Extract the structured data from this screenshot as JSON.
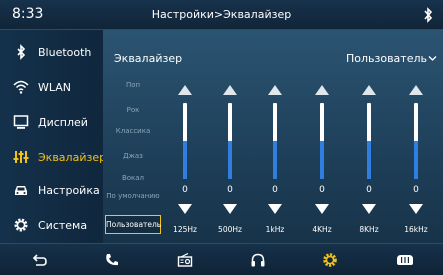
{
  "status": {
    "time": "8:33",
    "title": "Настройки>Эквалайзер",
    "bluetooth_icon": "bluetooth-icon"
  },
  "sidebar": {
    "items": [
      {
        "label": "Bluetooth",
        "icon": "bluetooth-icon",
        "active": false
      },
      {
        "label": "WLAN",
        "icon": "wifi-icon",
        "active": false
      },
      {
        "label": "Дисплей",
        "icon": "display-icon",
        "active": false
      },
      {
        "label": "Эквалайзер",
        "icon": "equalizer-icon",
        "active": true
      },
      {
        "label": "Настройка",
        "icon": "car-icon",
        "active": false
      },
      {
        "label": "Система",
        "icon": "gear-icon",
        "active": false
      }
    ]
  },
  "equalizer": {
    "title": "Эквалайзер",
    "preset_selected": "Пользователь",
    "presets": [
      "Поп",
      "Рок",
      "Классика",
      "Джаз",
      "Вокал",
      "По умолчанию",
      "Пользователь"
    ],
    "bands": [
      {
        "freq": "125Hz",
        "value": "0",
        "level": 0.5
      },
      {
        "freq": "500Hz",
        "value": "0",
        "level": 0.5
      },
      {
        "freq": "1kHz",
        "value": "0",
        "level": 0.5
      },
      {
        "freq": "4KHz",
        "value": "0",
        "level": 0.5
      },
      {
        "freq": "8KHz",
        "value": "0",
        "level": 0.5
      },
      {
        "freq": "16kHz",
        "value": "0",
        "level": 0.5
      }
    ]
  },
  "bottom_nav": [
    "back-icon",
    "phone-icon",
    "radio-icon",
    "headphones-icon",
    "settings-icon",
    "car-control-icon"
  ],
  "colors": {
    "accent": "#f3c218",
    "slider_fill": "#2f7ee0"
  }
}
